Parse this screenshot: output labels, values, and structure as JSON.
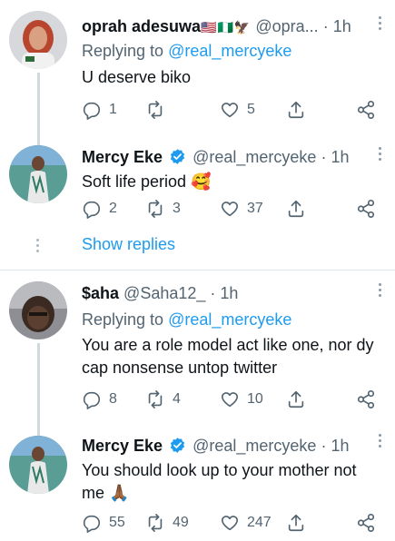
{
  "tweets": [
    {
      "name": "oprah adesuwa",
      "flags": "🇺🇸🇳🇬🦅",
      "handle": "@opra...",
      "dot": "·",
      "time": "1h",
      "replying_label": "Replying to ",
      "replying_handle": "@real_mercyeke",
      "text": "U deserve biko",
      "replies": "1",
      "retweets": "",
      "likes": "5"
    },
    {
      "name": "Mercy Eke",
      "verified": true,
      "handle": "@real_mercyeke",
      "dot": "·",
      "time": "1h",
      "text": "Soft life period 🥰",
      "replies": "2",
      "retweets": "3",
      "likes": "37"
    },
    {
      "name": "$aha",
      "handle": "@Saha12_",
      "dot": "·",
      "time": "1h",
      "replying_label": "Replying to ",
      "replying_handle": "@real_mercyeke",
      "text": "You are a role model act like one, nor dy cap nonsense untop twitter",
      "replies": "8",
      "retweets": "4",
      "likes": "10"
    },
    {
      "name": "Mercy Eke",
      "verified": true,
      "handle": "@real_mercyeke",
      "dot": "·",
      "time": "1h",
      "text": "You should look up to your mother not me 🙏🏾",
      "replies": "55",
      "retweets": "49",
      "likes": "247"
    }
  ],
  "show_replies": "Show replies",
  "colors": {
    "accent": "#1d9bf0",
    "secondary_text": "#536471",
    "divider": "#e1e8ed"
  }
}
